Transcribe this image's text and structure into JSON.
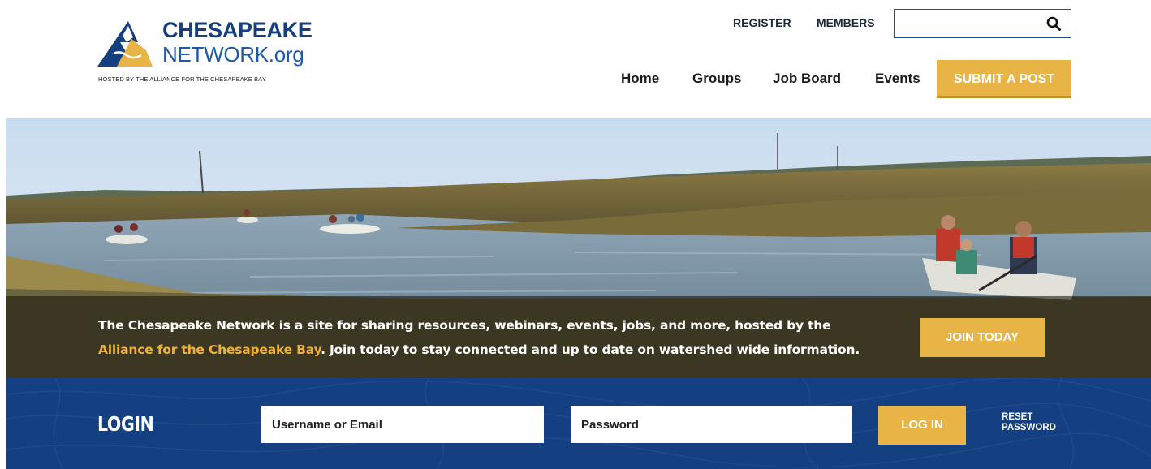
{
  "logo": {
    "line1": "CHESAPEAKE",
    "line2": "NETWORK.org",
    "tagline": "HOSTED BY THE ALLIANCE FOR THE CHESAPEAKE BAY"
  },
  "top_links": {
    "register": "REGISTER",
    "members": "MEMBERS"
  },
  "search": {
    "value": "",
    "placeholder": "",
    "icon": "search-icon"
  },
  "nav": {
    "home": "Home",
    "groups": "Groups",
    "job_board": "Job Board",
    "events": "Events",
    "submit": "SUBMIT A POST"
  },
  "hero": {
    "text_before": "The Chesapeake Network is a site for sharing resources, webinars, events, jobs, and more, hosted by the",
    "link": "Alliance for the Chesapeake Bay",
    "text_after": ". Join today to stay connected and up to date on watershed wide information.",
    "join_button": "JOIN TODAY"
  },
  "login": {
    "title": "LOGIN",
    "username_placeholder": "Username or Email",
    "password_placeholder": "Password",
    "button": "LOG IN",
    "reset_line1": "RESET",
    "reset_line2": "PASSWORD"
  },
  "colors": {
    "brand_navy": "#163f7f",
    "accent_gold": "#e8b445",
    "login_band": "#143f80"
  }
}
